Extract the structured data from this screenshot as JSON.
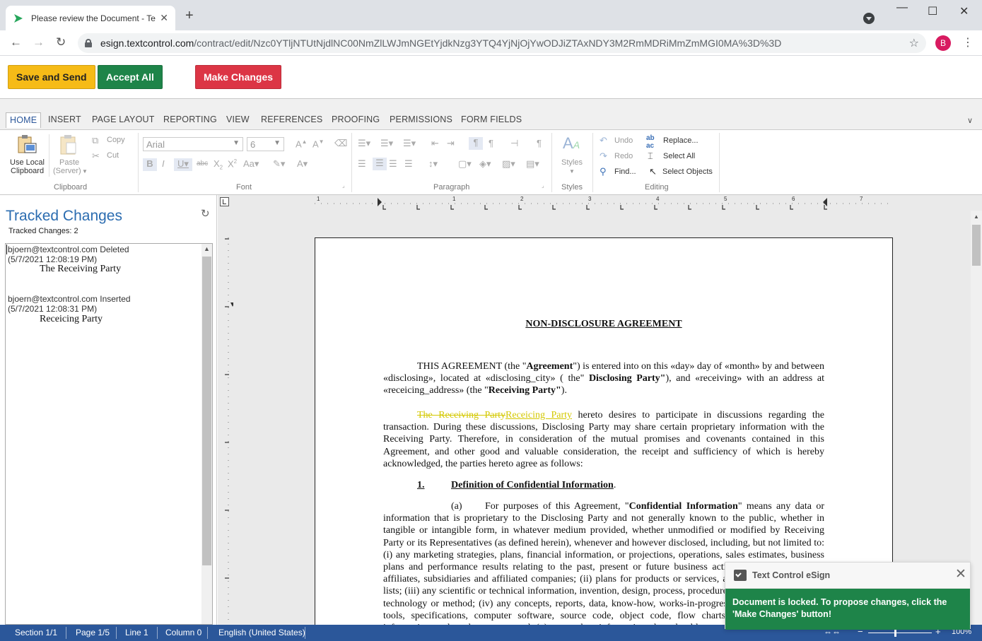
{
  "browser": {
    "tab_title": "Please review the Document - Te",
    "url_host": "esign.textcontrol.com",
    "url_path": "/contract/edit/Nzc0YTljNTUtNjdlNC00NmZlLWJmNGEtYjdkNzg3YTQ4YjNjOjYwODJiZTAxNDY3M2RmMDRiMmZmMGI0MA%3D%3D",
    "avatar_letter": "B"
  },
  "actions": {
    "save_send": "Save and Send",
    "accept_all": "Accept All",
    "make_changes": "Make Changes"
  },
  "ribbon": {
    "tabs": [
      "HOME",
      "INSERT",
      "PAGE LAYOUT",
      "REPORTING",
      "VIEW",
      "REFERENCES",
      "PROOFING",
      "PERMISSIONS",
      "FORM FIELDS"
    ],
    "clipboard": {
      "use_local_1": "Use Local",
      "use_local_2": "Clipboard",
      "paste_1": "Paste",
      "paste_2": "(Server)",
      "copy": "Copy",
      "cut": "Cut",
      "label": "Clipboard"
    },
    "font": {
      "name": "Arial",
      "size": "6",
      "label": "Font"
    },
    "paragraph": {
      "label": "Paragraph"
    },
    "styles": {
      "btn": "Styles",
      "label": "Styles"
    },
    "editing": {
      "undo": "Undo",
      "redo": "Redo",
      "find": "Find...",
      "replace": "Replace...",
      "select_all": "Select All",
      "select_objects": "Select Objects",
      "label": "Editing"
    }
  },
  "tracked": {
    "title": "Tracked Changes",
    "count_label": "Tracked Changes: 2",
    "items": [
      {
        "header": "bjoern@textcontrol.com Deleted",
        "time": "(5/7/2021 12:08:19 PM)",
        "text": "The Receiving Party"
      },
      {
        "header": "bjoern@textcontrol.com Inserted",
        "time": "(5/7/2021 12:08:31 PM)",
        "text": "Receicing Party"
      }
    ]
  },
  "ruler": {
    "h": [
      "1",
      "1",
      "2",
      "3",
      "4",
      "5",
      "6",
      "7"
    ]
  },
  "document": {
    "title": "NON-DISCLOSURE AGREEMENT",
    "p1_a": "THIS AGREEMENT (the \"",
    "p1_b": "Agreement",
    "p1_c": "\") is entered into on this «day» day of «month» by and between «disclosing», located at «disclosing_city» ( the\" ",
    "p1_d": "Disclosing Party\"",
    "p1_e": "), and «receiving» with an address at «receicing_address» (the \"",
    "p1_f": "Receiving Party\"",
    "p1_g": ").",
    "p2_del": "The Receiving Party",
    "p2_ins": "Receicing Party",
    "p2_rest": " hereto desires to participate in discussions regarding the transaction.  During these discussions, Disclosing Party may share certain proprietary information with the Receiving Party.  Therefore, in consideration of the mutual promises and covenants contained in this Agreement, and other good and valuable consideration, the receipt and sufficiency of which is hereby acknowledged, the parties hereto agree as follows:",
    "sec1_num": "1.",
    "sec1_title": "Definition of Confidential Information",
    "sec1_dot": ".",
    "a_label": "(a)",
    "a_text1": "For purposes of this Agreement, \"",
    "a_bold": "Confidential Information",
    "a_text2": "\" means any data or information that is proprietary to the Disclosing Party and not generally known to the public, whether in tangible or intangible form, in whatever medium provided, whether unmodified or modified by Receiving Party or its Representatives (as defined herein), whenever and however disclosed, including, but not limited to: (i) any marketing strategies, plans, financial information, or projections, operations, sales estimates, business plans and performance results relating to the past, present or future business activities of such party, its affiliates, subsidiaries and affiliated companies; (ii) plans for products or services, and customer or supplier lists; (iii) any scientific or technical information, invention, design, process, procedure, formula, improvement, technology or method; (iv) any concepts, reports, data, know-how, works-in-progress, designs, development tools, specifications, computer software, source code, object code, flow charts, databases, inventions, information and trade secrets; and (v) any other information that should reasonably be recognized as confidential information of the Disclosing Party."
  },
  "status": {
    "section": "Section 1/1",
    "page": "Page 1/5",
    "line": "Line 1",
    "column": "Column 0",
    "language": "English (United States)",
    "zoom": "100%"
  },
  "toast": {
    "title": "Text Control eSign",
    "message": "Document is locked. To propose changes, click the 'Make Changes' button!"
  },
  "colors": {
    "save": "#f6bb17",
    "accept": "#1e8449",
    "make": "#dc3545",
    "status": "#2b579a",
    "tracked_change": "#d4c800"
  }
}
